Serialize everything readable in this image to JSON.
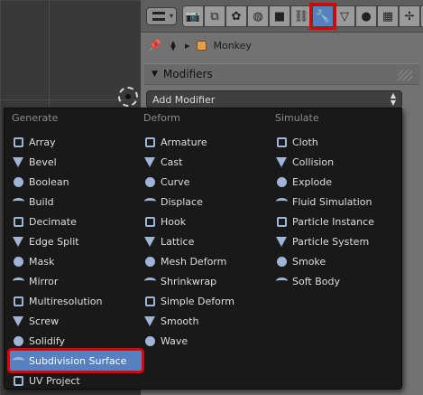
{
  "header": {
    "tabs": [
      {
        "icon": "render-icon",
        "glyph": "📷"
      },
      {
        "icon": "render-layers-icon",
        "glyph": "⧉"
      },
      {
        "icon": "scene-icon",
        "glyph": "✿"
      },
      {
        "icon": "world-icon",
        "glyph": "◍"
      },
      {
        "icon": "object-icon",
        "glyph": "■"
      },
      {
        "icon": "constraints-icon",
        "glyph": "⛓"
      },
      {
        "icon": "modifiers-wrench-icon",
        "glyph": "🔧"
      },
      {
        "icon": "object-data-icon",
        "glyph": "▽"
      },
      {
        "icon": "material-icon",
        "glyph": "●"
      },
      {
        "icon": "texture-icon",
        "glyph": "▦"
      },
      {
        "icon": "particles-icon",
        "glyph": "✢"
      },
      {
        "icon": "physics-icon",
        "glyph": "◎"
      }
    ],
    "active_tab": 6
  },
  "breadcrumb": {
    "object_name": "Monkey"
  },
  "panel": {
    "title": "Modifiers"
  },
  "add_modifier": {
    "label": "Add Modifier"
  },
  "menu": {
    "generate": {
      "heading": "Generate",
      "items": [
        "Array",
        "Bevel",
        "Boolean",
        "Build",
        "Decimate",
        "Edge Split",
        "Mask",
        "Mirror",
        "Multiresolution",
        "Screw",
        "Solidify",
        "Subdivision Surface",
        "UV Project"
      ]
    },
    "deform": {
      "heading": "Deform",
      "items": [
        "Armature",
        "Cast",
        "Curve",
        "Displace",
        "Hook",
        "Lattice",
        "Mesh Deform",
        "Shrinkwrap",
        "Simple Deform",
        "Smooth",
        "Wave"
      ]
    },
    "simulate": {
      "heading": "Simulate",
      "items": [
        "Cloth",
        "Collision",
        "Explode",
        "Fluid Simulation",
        "Particle Instance",
        "Particle System",
        "Smoke",
        "Soft Body"
      ]
    },
    "highlighted": "Subdivision Surface"
  },
  "colors": {
    "highlight": "#5680c2",
    "annotation_red": "#e00000",
    "menu_bg": "#191919"
  }
}
